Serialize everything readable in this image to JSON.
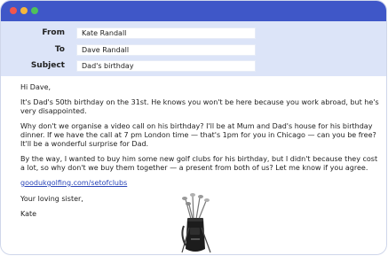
{
  "email": {
    "header": {
      "from_label": "From",
      "from_value": "Kate Randall",
      "to_label": "To",
      "to_value": "Dave Randall",
      "subject_label": "Subject",
      "subject_value": "Dad's birthday"
    },
    "body": {
      "greeting": "Hi Dave,",
      "paragraph1": "It's Dad's 50th birthday on the 31st. He knows you won't be here because you work abroad, but he's very disappointed.",
      "paragraph2": "Why don't we organise a video call on his birthday? I'll be at Mum and Dad's house for his birthday dinner. If we have the call at 7 pm London time — that's 1pm for you in Chicago — can you be free? It'll be a wonderful surprise for Dad.",
      "paragraph3": "By the way, I wanted to buy him some new golf clubs for his birthday, but I didn't because they cost a lot, so why don't we buy them together — a present from both of us? Let me know if you agree.",
      "link_text": "goodukgolfing.com/setofclubs",
      "closing": "Your loving sister,",
      "signature": "Kate"
    }
  },
  "colors": {
    "titlebar": "#3f57c8",
    "header_panel": "#dce4f8",
    "link": "#2a45b8",
    "dot_red": "#f2564d",
    "dot_yellow": "#f6b73c",
    "dot_green": "#4fc15a"
  },
  "icons": {
    "window_controls": [
      "close-dot",
      "minimize-dot",
      "maximize-dot"
    ],
    "image": "golf-bag-with-clubs"
  }
}
